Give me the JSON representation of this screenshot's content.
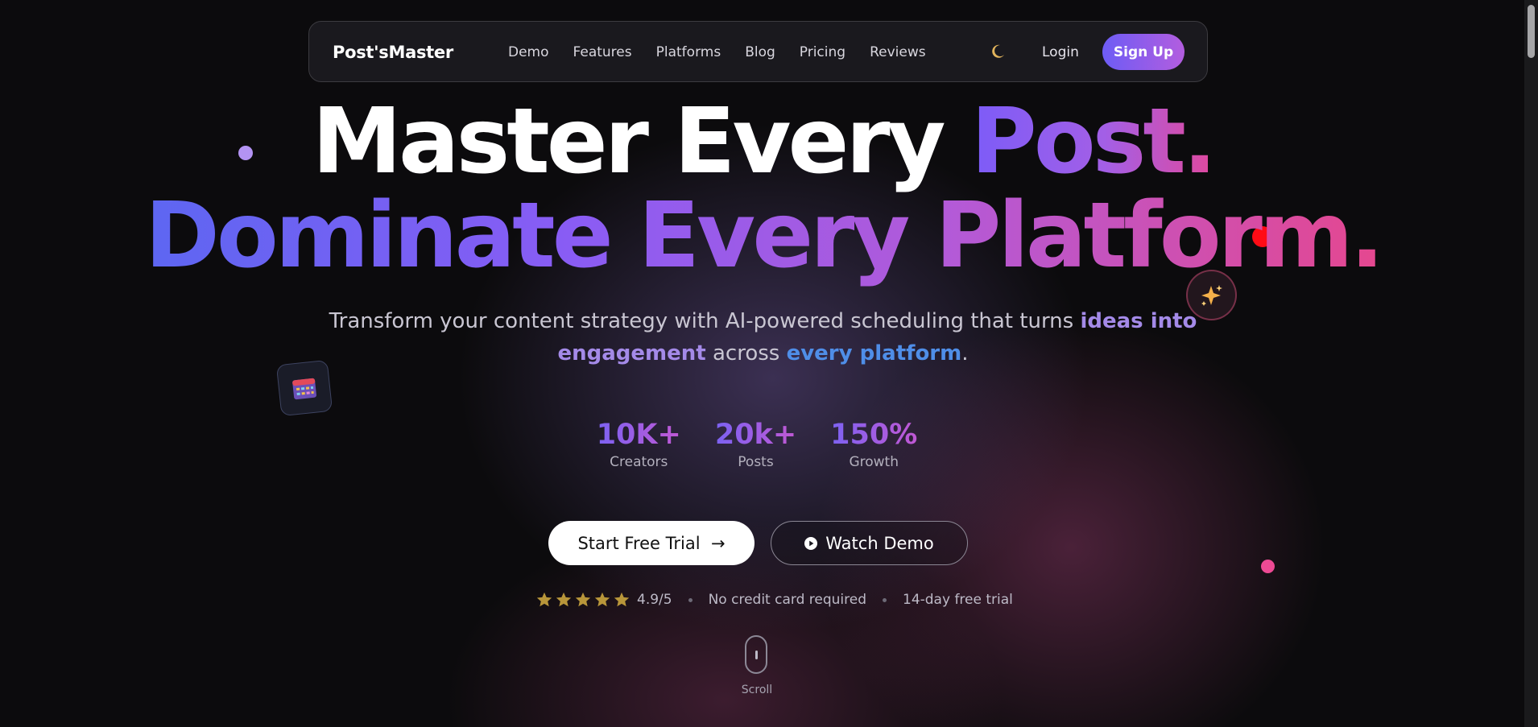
{
  "nav": {
    "brand": "Post'sMaster",
    "links": [
      {
        "label": "Demo"
      },
      {
        "label": "Features"
      },
      {
        "label": "Platforms"
      },
      {
        "label": "Blog"
      },
      {
        "label": "Pricing"
      },
      {
        "label": "Reviews"
      }
    ],
    "theme_icon": "moon-icon",
    "login_label": "Login",
    "signup_label": "Sign Up"
  },
  "hero": {
    "line1_white": "Master Every ",
    "line1_gradient": "Post.",
    "line2": "Dominate Every Platform.",
    "subtitle": {
      "part1": "Transform your content strategy with AI-powered scheduling that turns ",
      "highlight1": "ideas into engagement",
      "part2": " across ",
      "highlight2": "every platform",
      "part3": "."
    }
  },
  "stats": [
    {
      "value": "10K+",
      "label": "Creators"
    },
    {
      "value": "20k+",
      "label": "Posts"
    },
    {
      "value": "150%",
      "label": "Growth"
    }
  ],
  "cta": {
    "primary_label": "Start Free Trial",
    "primary_arrow": "→",
    "secondary_label": "Watch Demo"
  },
  "trust": {
    "rating": 5,
    "rating_text": "4.9/5",
    "item1": "No credit card required",
    "item2": "14-day free trial"
  },
  "scroll": {
    "label": "Scroll"
  },
  "colors": {
    "accent_start": "#6d5cf5",
    "accent_end": "#e5478f",
    "background": "#0c0b0d",
    "star": "#b8963a"
  }
}
